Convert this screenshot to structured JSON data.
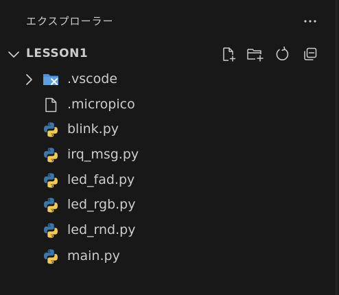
{
  "explorer": {
    "title": "エクスプローラー",
    "more_icon": "ellipsis-icon"
  },
  "section": {
    "title": "LESSON1",
    "expanded": true,
    "actions": [
      {
        "name": "new-file-button",
        "icon": "new-file-icon"
      },
      {
        "name": "new-folder-button",
        "icon": "new-folder-icon"
      },
      {
        "name": "refresh-button",
        "icon": "refresh-icon"
      },
      {
        "name": "collapse-all-button",
        "icon": "collapse-all-icon"
      }
    ]
  },
  "tree": {
    "items": [
      {
        "label": ".vscode",
        "type": "folder",
        "icon": "vscode-folder-icon",
        "expanded": false
      },
      {
        "label": ".micropico",
        "type": "file",
        "icon": "file-icon"
      },
      {
        "label": "blink.py",
        "type": "file",
        "icon": "python-icon"
      },
      {
        "label": "irq_msg.py",
        "type": "file",
        "icon": "python-icon"
      },
      {
        "label": "led_fad.py",
        "type": "file",
        "icon": "python-icon"
      },
      {
        "label": "led_rgb.py",
        "type": "file",
        "icon": "python-icon"
      },
      {
        "label": "led_rnd.py",
        "type": "file",
        "icon": "python-icon"
      },
      {
        "label": "main.py",
        "type": "file",
        "icon": "python-icon"
      }
    ]
  },
  "colors": {
    "background": "#181818",
    "text": "#cccccc",
    "folder_blue": "#4a8fd6",
    "python_blue": "#3b77a8",
    "python_yellow": "#f7c948"
  }
}
